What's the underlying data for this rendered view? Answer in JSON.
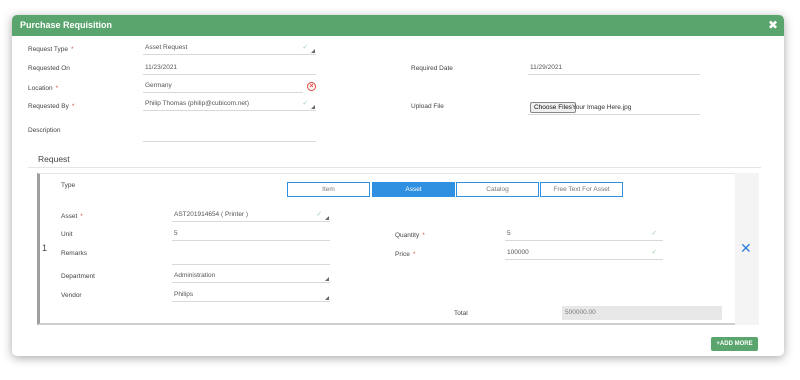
{
  "dialog": {
    "title": "Purchase Requisition",
    "close": "✖"
  },
  "header_form": {
    "request_type": {
      "label": "Request Type",
      "value": "Asset Request"
    },
    "requested_on": {
      "label": "Requested On",
      "value": "11/23/2021"
    },
    "required_date": {
      "label": "Required Date",
      "value": "11/29/2021"
    },
    "location": {
      "label": "Location",
      "value": "Germany"
    },
    "requested_by": {
      "label": "Requested By",
      "value": "Philip Thomas (philip@cubicom.net)"
    },
    "upload_file": {
      "label": "Upload File",
      "button": "Choose Files",
      "file_name": "Your Image Here.jpg"
    },
    "description": {
      "label": "Description",
      "value": ""
    }
  },
  "request_section": {
    "title": "Request",
    "row_number": "1",
    "type_label": "Type",
    "tabs": [
      "Item",
      "Asset",
      "Catalog",
      "Free Text For Asset"
    ],
    "active_tab": "Asset",
    "asset": {
      "label": "Asset",
      "value": "AST201914654 ( Printer )"
    },
    "unit": {
      "label": "Unit",
      "value": "5"
    },
    "quantity": {
      "label": "Quantity",
      "value": "5"
    },
    "remarks": {
      "label": "Remarks",
      "value": ""
    },
    "price": {
      "label": "Price",
      "value": "100000"
    },
    "department": {
      "label": "Department",
      "value": "Administration"
    },
    "vendor": {
      "label": "Vendor",
      "value": "Philips"
    },
    "total": {
      "label": "Total",
      "value": "500000.00"
    },
    "remove": "✕"
  },
  "actions": {
    "add_more": "+ADD MORE"
  },
  "colors": {
    "header_green": "#5aa56d",
    "tab_blue": "#2f8fe0",
    "required_red": "#d9534f"
  }
}
